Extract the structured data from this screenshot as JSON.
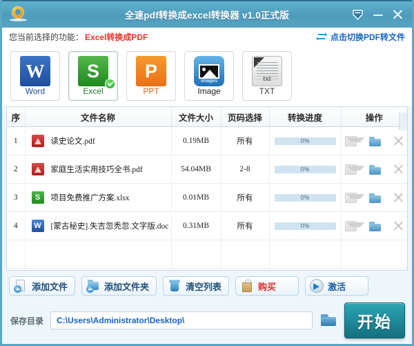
{
  "window": {
    "title": "全速pdf转换成excel转换器 v1.0正式版",
    "logo_icon": "convert-circle-logo",
    "controls": {
      "collapse_icon": "down-arrow-badge-icon",
      "minimize_icon": "minimize-icon",
      "close_icon": "close-icon"
    }
  },
  "function_bar": {
    "label": "您当前选择的功能：",
    "value": "Excel转换成PDF",
    "switch_link": "点击切换PDF转文件",
    "switch_icon": "swap-arrows-icon"
  },
  "formats": [
    {
      "label": "Word",
      "icon": "word-icon",
      "selected": false
    },
    {
      "label": "Excel",
      "icon": "excel-icon",
      "selected": true
    },
    {
      "label": "PPT",
      "icon": "ppt-icon",
      "selected": false
    },
    {
      "label": "Image",
      "icon": "image-icon",
      "selected": false
    },
    {
      "label": "TXT",
      "icon": "txt-icon",
      "selected": false
    }
  ],
  "table": {
    "columns": [
      "序",
      "文件名称",
      "文件大小",
      "页码选择",
      "转换进度",
      "操作"
    ],
    "rows": [
      {
        "index": "1",
        "name": "读史论文.pdf",
        "type": "pdf",
        "size": "0.19MB",
        "pages": "所有",
        "progress": "0%"
      },
      {
        "index": "2",
        "name": "家庭生活实用技巧全书.pdf",
        "type": "pdf",
        "size": "54.04MB",
        "pages": "2-8",
        "progress": "0%"
      },
      {
        "index": "3",
        "name": "项目免费推广方案.xlsx",
        "type": "xls",
        "size": "0.01MB",
        "pages": "所有",
        "progress": "0%"
      },
      {
        "index": "4",
        "name": "[蒙古秘史].失吉忽秃忽.文字版.doc",
        "type": "doc",
        "size": "0.31MB",
        "pages": "所有",
        "progress": "0%"
      }
    ],
    "row_actions": {
      "mail_icon": "mail-icon",
      "folder_icon": "open-folder-icon",
      "remove_icon": "remove-close-icon"
    }
  },
  "toolbar": [
    {
      "label": "添加文件",
      "icon": "add-file-icon"
    },
    {
      "label": "添加文件夹",
      "icon": "add-folder-icon"
    },
    {
      "label": "清空列表",
      "icon": "trash-icon"
    },
    {
      "label": "购买",
      "icon": "shopping-bag-icon"
    },
    {
      "label": "激活",
      "icon": "activate-arrow-icon"
    }
  ],
  "save_row": {
    "label": "保存目录",
    "path": "C:\\Users\\Administrator\\Desktop\\",
    "browse_icon": "browse-folder-icon",
    "start_label": "开始"
  },
  "colors": {
    "titlebar": "#55a4c3",
    "accent_red": "#e8322a",
    "link_blue": "#1464c8",
    "start_teal": "#1f8d9e",
    "progress_track": "#cfe4f0"
  }
}
